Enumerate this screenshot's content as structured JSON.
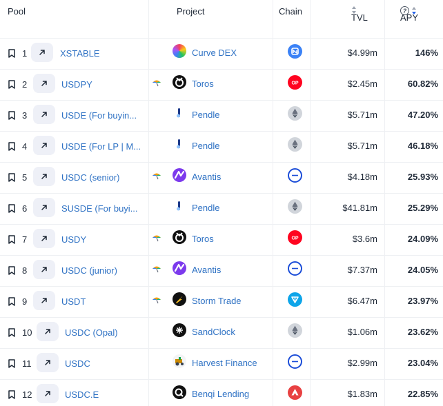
{
  "header": {
    "pool": "Pool",
    "project": "Project",
    "chain": "Chain",
    "tvl": "TVL",
    "apy": "APY",
    "apy_help": "?"
  },
  "rows": [
    {
      "rank": "1",
      "pool": "XSTABLE",
      "project": "Curve DEX",
      "project_icon": "curve-logo",
      "chain_icon": "ethereum-logo-blue",
      "tvl": "$4.99m",
      "apy": "146%",
      "umbrella": false
    },
    {
      "rank": "2",
      "pool": "USDPY",
      "project": "Toros",
      "project_icon": "toros-logo",
      "chain_icon": "optimism-logo",
      "tvl": "$2.45m",
      "apy": "60.82%",
      "umbrella": true
    },
    {
      "rank": "3",
      "pool": "USDE (For buyin...",
      "project": "Pendle",
      "project_icon": "pendle-logo",
      "chain_icon": "ethereum-logo",
      "tvl": "$5.71m",
      "apy": "47.20%",
      "umbrella": false
    },
    {
      "rank": "4",
      "pool": "USDE (For LP | M...",
      "project": "Pendle",
      "project_icon": "pendle-logo",
      "chain_icon": "ethereum-logo",
      "tvl": "$5.71m",
      "apy": "46.18%",
      "umbrella": false
    },
    {
      "rank": "5",
      "pool": "USDC (senior)",
      "project": "Avantis",
      "project_icon": "avantis-logo",
      "chain_icon": "base-logo",
      "tvl": "$4.18m",
      "apy": "25.93%",
      "umbrella": true
    },
    {
      "rank": "6",
      "pool": "SUSDE (For buyi...",
      "project": "Pendle",
      "project_icon": "pendle-logo",
      "chain_icon": "ethereum-logo",
      "tvl": "$41.81m",
      "apy": "25.29%",
      "umbrella": false
    },
    {
      "rank": "7",
      "pool": "USDY",
      "project": "Toros",
      "project_icon": "toros-logo",
      "chain_icon": "optimism-logo",
      "tvl": "$3.6m",
      "apy": "24.09%",
      "umbrella": true
    },
    {
      "rank": "8",
      "pool": "USDC (junior)",
      "project": "Avantis",
      "project_icon": "avantis-logo",
      "chain_icon": "base-logo",
      "tvl": "$7.37m",
      "apy": "24.05%",
      "umbrella": true
    },
    {
      "rank": "9",
      "pool": "USDT",
      "project": "Storm Trade",
      "project_icon": "storm-logo",
      "chain_icon": "ton-logo",
      "tvl": "$6.47m",
      "apy": "23.97%",
      "umbrella": true
    },
    {
      "rank": "10",
      "pool": "USDC (Opal)",
      "project": "SandClock",
      "project_icon": "sandclock-logo",
      "chain_icon": "ethereum-logo",
      "tvl": "$1.06m",
      "apy": "23.62%",
      "umbrella": false
    },
    {
      "rank": "11",
      "pool": "USDC",
      "project": "Harvest Finance",
      "project_icon": "harvest-logo",
      "chain_icon": "base-logo",
      "tvl": "$2.99m",
      "apy": "23.04%",
      "umbrella": false
    },
    {
      "rank": "12",
      "pool": "USDC.E",
      "project": "Benqi Lending",
      "project_icon": "benqi-logo",
      "chain_icon": "avalanche-logo",
      "tvl": "$1.83m",
      "apy": "22.85%",
      "umbrella": false
    }
  ],
  "colors": {
    "link": "#2f72c4",
    "divider": "#eef0f3",
    "button_bg": "#eef0f7"
  }
}
